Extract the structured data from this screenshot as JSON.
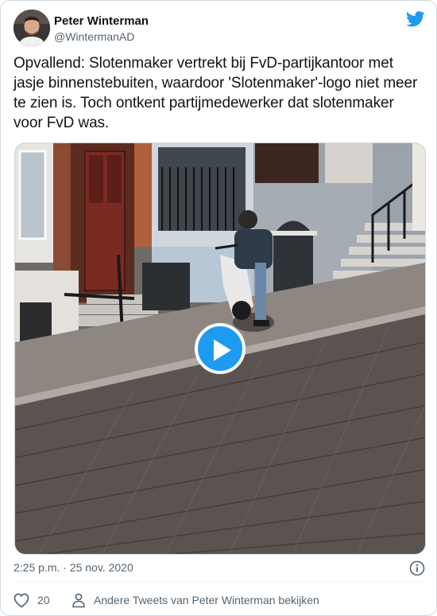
{
  "author": {
    "name": "Peter Winterman",
    "handle": "@WintermanAD"
  },
  "tweet": {
    "text": "Opvallend: Slotenmaker vertrekt bij FvD-partijkantoor met jasje binnenstebuiten, waardoor 'Slotenmaker'-logo niet meer te zien is. Toch ontkent partijmedewerker dat slotenmaker voor FvD was."
  },
  "media": {
    "type": "video",
    "play_icon": "play-icon"
  },
  "meta": {
    "timestamp": "2:25 p.m. · 25 nov. 2020",
    "info_icon": "info-icon"
  },
  "actions": {
    "like_count": "20",
    "like_icon": "heart-icon",
    "profile_icon": "person-icon",
    "profile_link_label": "Andere Tweets van Peter Winterman bekijken"
  },
  "colors": {
    "accent": "#1d9bf0",
    "text_primary": "#0f1419",
    "text_secondary": "#536471",
    "border": "#cfd9de"
  }
}
